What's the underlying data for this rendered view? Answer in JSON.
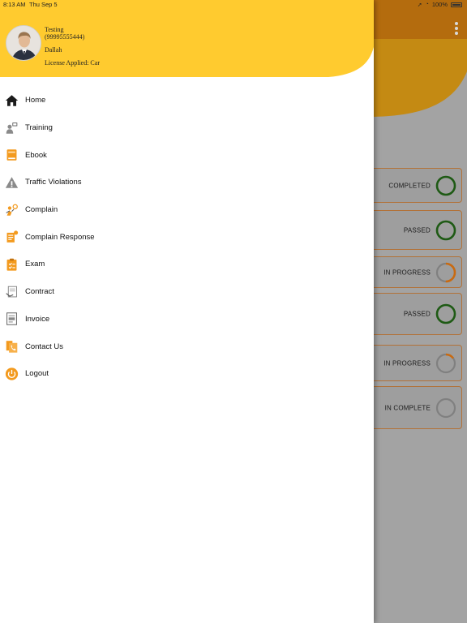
{
  "status_bar": {
    "time": "8:13 AM",
    "date": "Thu Sep 5",
    "battery": "100%"
  },
  "profile": {
    "name": "Testing",
    "phone": "(99995555444)",
    "city": "Dallah",
    "license": "License Applied: Car"
  },
  "menu": [
    {
      "label": "Home",
      "icon": "home-icon"
    },
    {
      "label": "Training",
      "icon": "training-icon"
    },
    {
      "label": "Ebook",
      "icon": "ebook-icon"
    },
    {
      "label": "Traffic Violations",
      "icon": "traffic-violation-icon"
    },
    {
      "label": "Complain",
      "icon": "complain-icon"
    },
    {
      "label": "Complain Response",
      "icon": "complain-response-icon"
    },
    {
      "label": "Exam",
      "icon": "exam-icon"
    },
    {
      "label": "Contract",
      "icon": "contract-icon"
    },
    {
      "label": "Invoice",
      "icon": "invoice-icon"
    },
    {
      "label": "Contact Us",
      "icon": "contact-icon"
    },
    {
      "label": "Logout",
      "icon": "logout-icon"
    }
  ],
  "background_cards": [
    {
      "status": "COMPLETED",
      "progress": 1.0,
      "ring_color": "#1e5a14"
    },
    {
      "status": "PASSED",
      "progress": 1.0,
      "ring_color": "#1e5a14"
    },
    {
      "status": "IN PROGRESS",
      "progress": 0.5,
      "ring_color": "#c96a10"
    },
    {
      "status": "PASSED",
      "progress": 1.0,
      "ring_color": "#1e5a14"
    },
    {
      "status": "IN PROGRESS",
      "progress": 0.15,
      "ring_color": "#c96a10"
    },
    {
      "status": "IN COMPLETE",
      "progress": 0.0,
      "ring_color": "#777777"
    }
  ],
  "colors": {
    "header_yellow": "#ffcb2f",
    "accent_orange": "#f39a1e",
    "topbar_dim": "#b46c0e"
  }
}
